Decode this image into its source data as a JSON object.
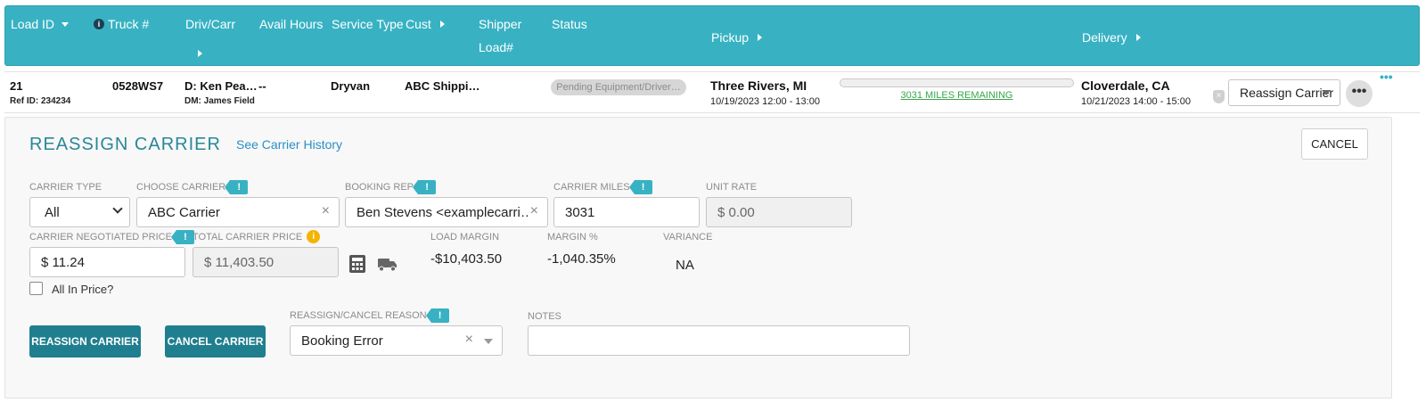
{
  "header": {
    "load_id": "Load ID",
    "truck": "Truck #",
    "driv_carr": "Driv/Carr",
    "avail_hours": "Avail Hours",
    "service_type": "Service Type",
    "cust": "Cust",
    "shipper": "Shipper",
    "load_no": "Load#",
    "status": "Status",
    "pickup": "Pickup",
    "delivery": "Delivery"
  },
  "load_row": {
    "load_id": "21",
    "ref_id": "Ref ID: 234234",
    "truck": "0528WS7",
    "driver": "D: Ken Pea…",
    "dm": "DM: James Field",
    "avail_hours": "--",
    "service_type": "Dryvan",
    "customer": "ABC Shippi…",
    "status": "Pending Equipment/Driver…",
    "pickup_city": "Three Rivers, MI",
    "pickup_time": "10/19/2023 12:00 - 13:00",
    "miles_remaining": "3031 MILES REMAINING",
    "progress_fraction": 0.0,
    "delivery_city": "Cloverdale, CA",
    "delivery_time": "10/21/2023 14:00 - 15:00",
    "action_select": "Reassign Carrier",
    "more": "•••",
    "corner_dots": "•••"
  },
  "panel": {
    "title": "REASSIGN CARRIER",
    "history_link": "See Carrier History",
    "cancel_top": "CANCEL",
    "labels": {
      "carrier_type": "CARRIER TYPE",
      "choose_carrier": "CHOOSE CARRIER",
      "booking_rep": "BOOKING REP",
      "carrier_miles": "CARRIER MILES",
      "unit_rate": "UNIT RATE",
      "carrier_negotiated_price": "CARRIER NEGOTIATED PRICE",
      "total_carrier_price": "TOTAL CARRIER PRICE",
      "load_margin": "LOAD MARGIN",
      "margin_pct": "MARGIN %",
      "variance": "VARIANCE",
      "reason": "REASSIGN/CANCEL REASON",
      "notes": "NOTES",
      "all_in_price": "All In Price?"
    },
    "values": {
      "carrier_type": "All",
      "carrier": "ABC Carrier",
      "booking_rep": "Ben Stevens <examplecarri…",
      "carrier_miles": "3031",
      "unit_rate": "$ 0.00",
      "negotiated_price": "$ 11.24",
      "total_carrier_price": "$ 11,403.50",
      "load_margin": "-$10,403.50",
      "margin_pct": "-1,040.35%",
      "variance": "NA",
      "reason": "Booking Error",
      "notes": ""
    },
    "buttons": {
      "reassign": "REASSIGN CARRIER",
      "cancel_carrier": "CANCEL CARRIER"
    },
    "flag_text": "!",
    "info_text": "i"
  },
  "colors": {
    "header_bg": "#38b2c3",
    "accent_dark": "#1f7f8f",
    "link": "#2a8fc9",
    "miles_green": "#3aa64a",
    "info_yellow": "#f4b400"
  }
}
